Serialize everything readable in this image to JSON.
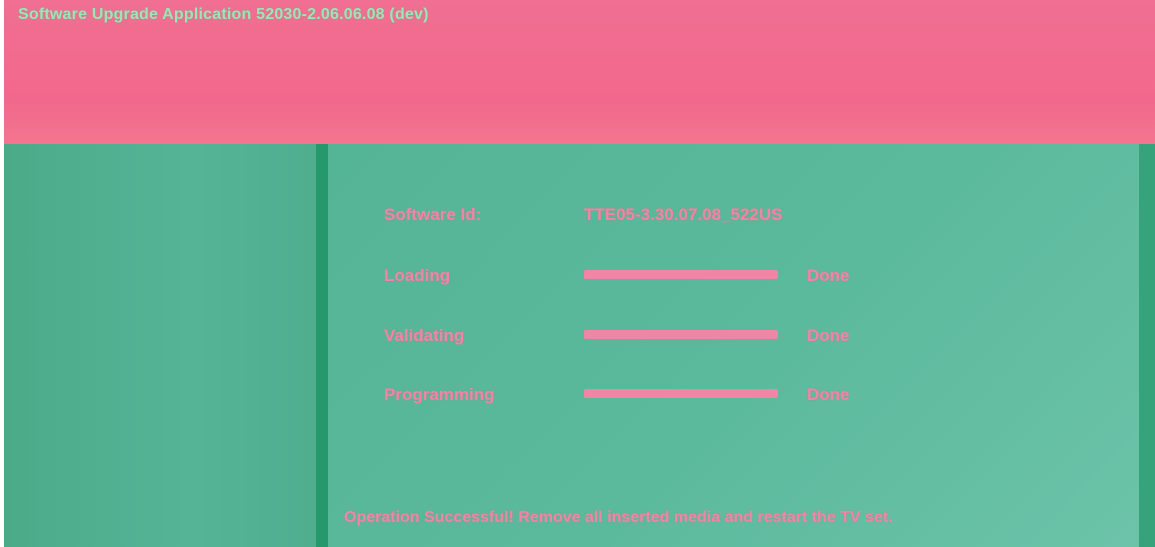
{
  "header": {
    "title": "Software Upgrade Application 52030-2.06.06.08 (dev)"
  },
  "software": {
    "id_label": "Software Id:",
    "id_value": "TTE05-3.30.07.08_522US"
  },
  "steps": [
    {
      "label": "Loading",
      "status": "Done",
      "progress": 1.0
    },
    {
      "label": "Validating",
      "status": "Done",
      "progress": 1.0
    },
    {
      "label": "Programming",
      "status": "Done",
      "progress": 1.0
    }
  ],
  "message": "Operation Successful! Remove all inserted media and restart the TV set.",
  "colors": {
    "header_bg": "#f2688c",
    "panel_bg": "#5cba9c",
    "text": "#ef86a5",
    "title_text": "#9fe4b5"
  }
}
